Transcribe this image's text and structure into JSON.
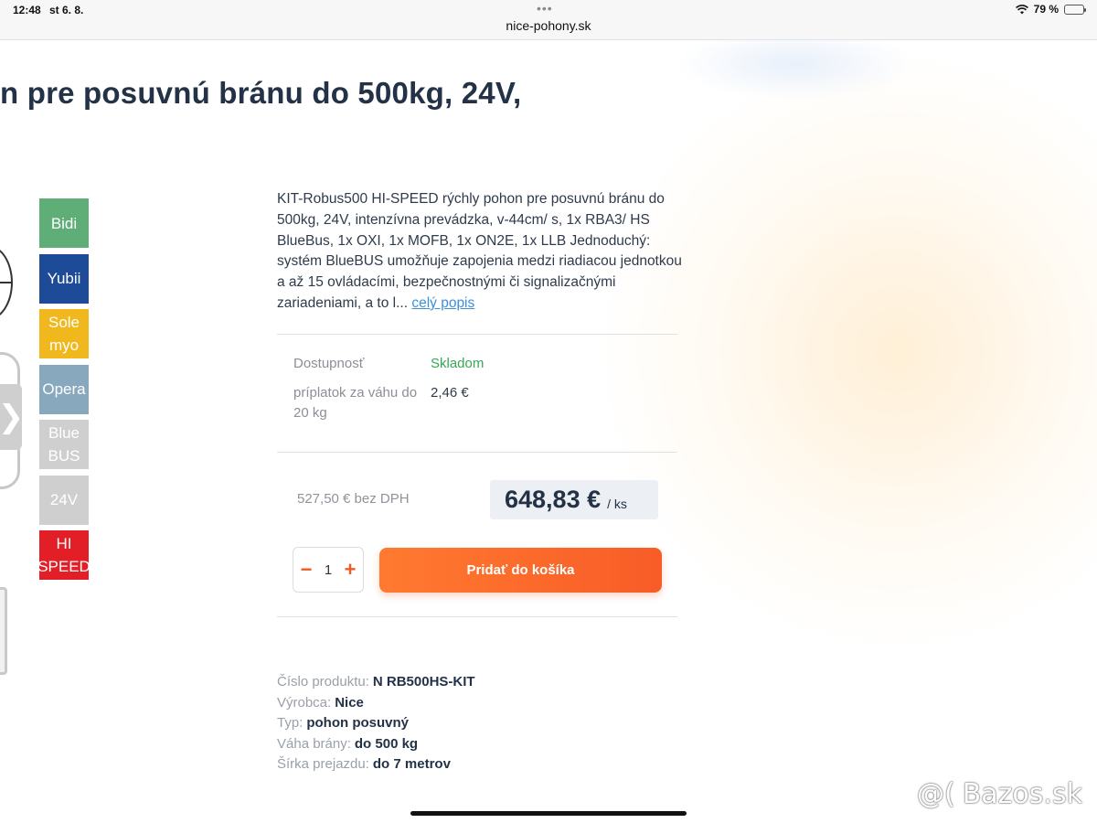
{
  "status_bar": {
    "time": "12:48",
    "date": "st 6. 8.",
    "url": "nice-pohony.sk",
    "battery": "79 %",
    "battery_level": 0.79
  },
  "product": {
    "title": "n pre posuvnú bránu do 500kg, 24V,",
    "description": "KIT-Robus500 HI-SPEED rýchly pohon pre posuvnú bránu do 500kg, 24V, intenzívna prevádzka, v-44cm/ s, 1x RBA3/ HS BlueBus, 1x OXI, 1x MOFB, 1x ON2E, 1x LLB Jednoduchý: systém BlueBUS umožňuje zapojenia medzi riadiacou jednotkou a až 15 ovládacími, bezpečnostnými či signalizačnými zariadeniami, a to l...",
    "more_link": "celý popis"
  },
  "badges": [
    {
      "label": "Bidi",
      "color": "#5fae78"
    },
    {
      "label": "Yubii",
      "color": "#1d4b97"
    },
    {
      "label": "Sole myo",
      "color": "#f1b81e"
    },
    {
      "label": "Opera",
      "color": "#87a8bd"
    },
    {
      "label": "Blue BUS",
      "color": "#cfcfcf"
    },
    {
      "label": "24V",
      "color": "#cfcfcf"
    },
    {
      "label": "HI SPEED",
      "color": "#e21e26"
    }
  ],
  "availability": {
    "label": "Dostupnosť",
    "value": "Skladom",
    "value_color": "#34a853"
  },
  "surcharge": {
    "label": "príplatok za váhu do 20 kg",
    "value": "2,46 €"
  },
  "price": {
    "net": "527,50 € bez DPH",
    "gross": "648,83 €",
    "unit": "/ ks"
  },
  "quantity": {
    "minus": "−",
    "value": "1",
    "plus": "+"
  },
  "cart_button": "Pridať do košíka",
  "specs": [
    {
      "label": "Číslo produktu:",
      "value": "N RB500HS-KIT"
    },
    {
      "label": "Výrobca:",
      "value": "Nice"
    },
    {
      "label": "Typ:",
      "value": "pohon posuvný"
    },
    {
      "label": "Váha brány:",
      "value": "do 500 kg"
    },
    {
      "label": "Šírka prejazdu:",
      "value": "do 7 metrov"
    }
  ],
  "watermark": {
    "logo": "@(",
    "text": "Bazos.sk"
  }
}
